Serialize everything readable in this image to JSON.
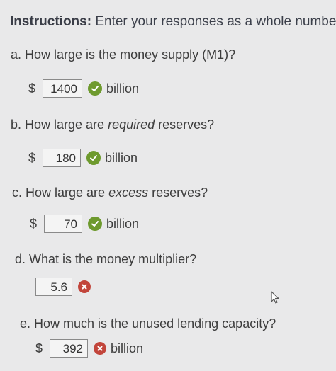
{
  "instructions": {
    "label": "Instructions:",
    "text": "Enter your responses as a whole number."
  },
  "questions": {
    "a": {
      "prompt": "a. How large is the money supply (M1)?",
      "currency": "$",
      "value": "1400",
      "unit": "billion",
      "status": "correct"
    },
    "b": {
      "prompt_pre": "b. How large are ",
      "prompt_em": "required",
      "prompt_post": " reserves?",
      "currency": "$",
      "value": "180",
      "unit": "billion",
      "status": "correct"
    },
    "c": {
      "prompt_pre": "c. How large are ",
      "prompt_em": "excess",
      "prompt_post": " reserves?",
      "currency": "$",
      "value": "70",
      "unit": "billion",
      "status": "correct"
    },
    "d": {
      "prompt": "d. What is the money multiplier?",
      "value": "5.6",
      "status": "incorrect"
    },
    "e": {
      "prompt": "e. How much is the unused lending capacity?",
      "currency": "$",
      "value": "392",
      "unit": "billion",
      "status": "incorrect"
    }
  },
  "icons": {
    "correct": "check-circle-icon",
    "incorrect": "x-circle-icon",
    "cursor": "mouse-pointer-icon"
  },
  "colors": {
    "correct": "#6e9a2e",
    "incorrect": "#c2453b"
  }
}
